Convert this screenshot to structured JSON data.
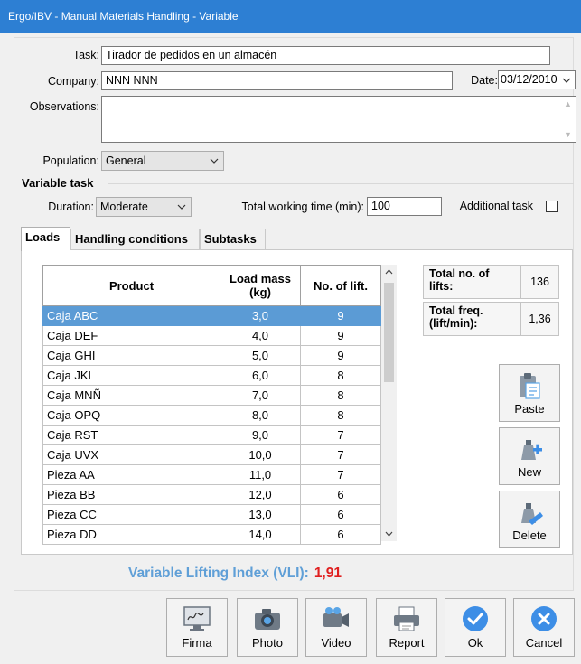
{
  "window": {
    "title": "Ergo/IBV - Manual Materials Handling - Variable"
  },
  "form": {
    "task_label": "Task:",
    "task_value": "Tirador de pedidos en un almacén",
    "company_label": "Company:",
    "company_value": "NNN NNN",
    "date_label": "Date:",
    "date_value": "03/12/2010",
    "observations_label": "Observations:",
    "observations_value": "",
    "population_label": "Population:",
    "population_value": "General"
  },
  "variable_task": {
    "title": "Variable task",
    "duration_label": "Duration:",
    "duration_value": "Moderate",
    "total_time_label": "Total working time (min):",
    "total_time_value": "100",
    "additional_task_label": "Additional task",
    "additional_task_checked": false
  },
  "tabs": [
    {
      "label": "Loads",
      "active": true
    },
    {
      "label": "Handling conditions",
      "active": false
    },
    {
      "label": "Subtasks",
      "active": false
    }
  ],
  "table": {
    "headers": [
      "Product",
      "Load mass (kg)",
      "No. of lift."
    ],
    "rows": [
      {
        "product": "Caja ABC",
        "mass": "3,0",
        "lifts": "9",
        "selected": true
      },
      {
        "product": "Caja DEF",
        "mass": "4,0",
        "lifts": "9"
      },
      {
        "product": "Caja GHI",
        "mass": "5,0",
        "lifts": "9"
      },
      {
        "product": "Caja JKL",
        "mass": "6,0",
        "lifts": "8"
      },
      {
        "product": "Caja MNÑ",
        "mass": "7,0",
        "lifts": "8"
      },
      {
        "product": "Caja OPQ",
        "mass": "8,0",
        "lifts": "8"
      },
      {
        "product": "Caja RST",
        "mass": "9,0",
        "lifts": "7"
      },
      {
        "product": "Caja UVX",
        "mass": "10,0",
        "lifts": "7"
      },
      {
        "product": "Pieza AA",
        "mass": "11,0",
        "lifts": "7"
      },
      {
        "product": "Pieza BB",
        "mass": "12,0",
        "lifts": "6"
      },
      {
        "product": "Pieza CC",
        "mass": "13,0",
        "lifts": "6"
      },
      {
        "product": "Pieza DD",
        "mass": "14,0",
        "lifts": "6"
      }
    ]
  },
  "stats": {
    "total_lifts_label": "Total no. of lifts:",
    "total_lifts_value": "136",
    "total_freq_label": "Total freq. (lift/min):",
    "total_freq_value": "1,36"
  },
  "side_buttons": {
    "paste": "Paste",
    "new": "New",
    "delete": "Delete"
  },
  "vli": {
    "label": "Variable Lifting Index (VLI):",
    "value": "1,91"
  },
  "bottom_buttons": {
    "firma": "Firma",
    "photo": "Photo",
    "video": "Video",
    "report": "Report",
    "ok": "Ok",
    "cancel": "Cancel"
  },
  "colors": {
    "titlebar": "#2d7fd3",
    "selected_row": "#5b9bd5",
    "vli_label": "#5f9fd7",
    "vli_value": "#e02020"
  }
}
